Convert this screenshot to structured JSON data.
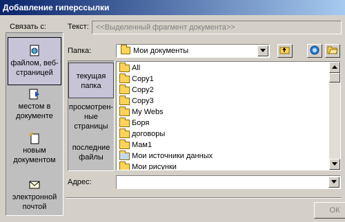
{
  "window": {
    "title": "Добавление гиперссылки"
  },
  "link_to": {
    "label": "Связать с:",
    "items": [
      {
        "label": "файлом, веб-страницей",
        "icon": "file-web-page-icon",
        "selected": true
      },
      {
        "label": "местом в документе",
        "icon": "place-in-document-icon",
        "selected": false
      },
      {
        "label": "новым документом",
        "icon": "new-document-icon",
        "selected": false
      },
      {
        "label": "электронной почтой",
        "icon": "email-icon",
        "selected": false
      }
    ]
  },
  "text_field": {
    "label": "Текст:",
    "value": "<<Выделенный фрагмент документа>>"
  },
  "folder": {
    "label": "Папка:",
    "value": "Мои документы"
  },
  "places": [
    {
      "label": "текущая папка",
      "selected": true
    },
    {
      "label": "просмотрен-ные страницы",
      "selected": false
    },
    {
      "label": "последние файлы",
      "selected": false
    }
  ],
  "files": [
    {
      "name": "All",
      "icon": "folder-icon"
    },
    {
      "name": "Copy1",
      "icon": "folder-icon"
    },
    {
      "name": "Copy2",
      "icon": "folder-icon"
    },
    {
      "name": "Copy3",
      "icon": "folder-icon"
    },
    {
      "name": "My Webs",
      "icon": "folder-icon"
    },
    {
      "name": "Боря",
      "icon": "folder-icon"
    },
    {
      "name": "договоры",
      "icon": "folder-icon"
    },
    {
      "name": "Мам1",
      "icon": "folder-icon"
    },
    {
      "name": "Мои источники данных",
      "icon": "data-sources-folder-icon"
    },
    {
      "name": "Мои рисунки",
      "icon": "folder-icon"
    }
  ],
  "address": {
    "label": "Адрес:",
    "value": ""
  },
  "buttons": {
    "ok": "ОК"
  }
}
